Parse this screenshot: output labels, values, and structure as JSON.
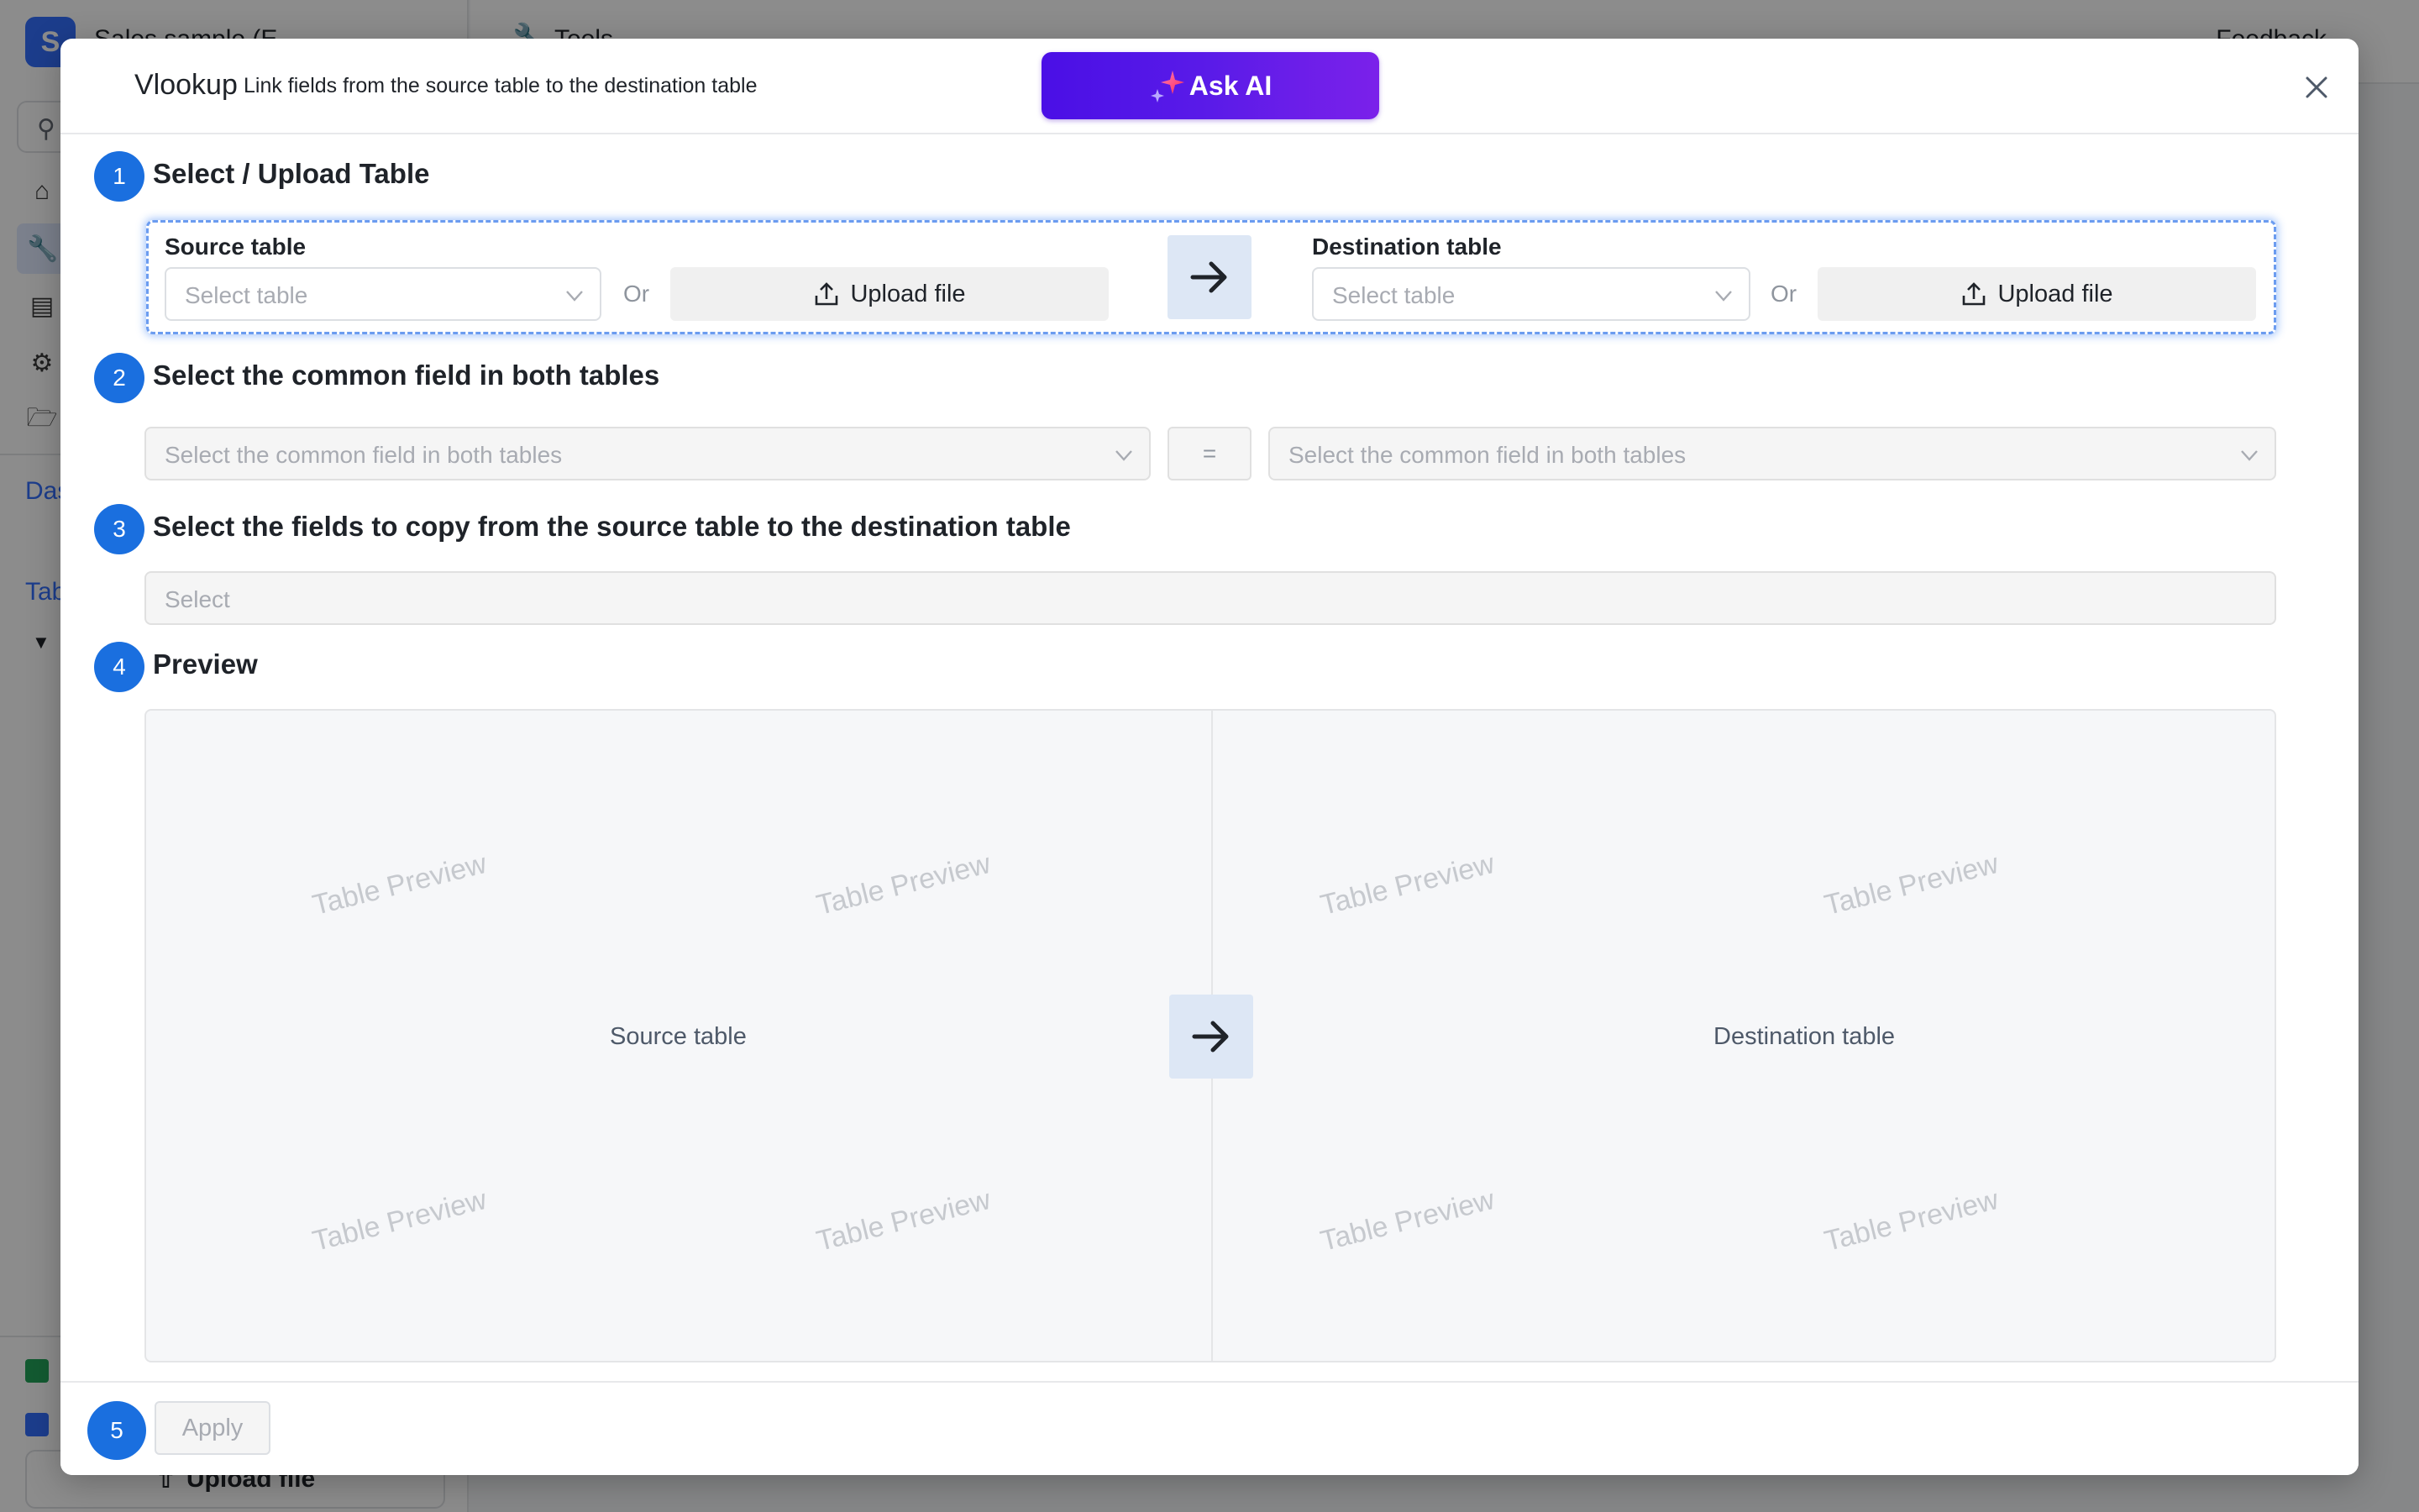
{
  "app": {
    "logo_letter": "S",
    "name": "Sales sample (E",
    "header_title": "Tools",
    "feedback": "Feedback",
    "section_dashboard": "Das",
    "section_tables": "Tab",
    "upload_file": "Upload file"
  },
  "modal": {
    "title": "Vlookup",
    "subtitle": "Link fields from the source table to the destination table",
    "ask_ai": "Ask AI",
    "steps": [
      {
        "number": "1",
        "title": "Select / Upload Table"
      },
      {
        "number": "2",
        "title": "Select the common field in both tables"
      },
      {
        "number": "3",
        "title": "Select the fields to copy from the source table to the destination table"
      },
      {
        "number": "4",
        "title": "Preview"
      },
      {
        "number": "5",
        "title": ""
      }
    ],
    "source": {
      "label": "Source table",
      "placeholder": "Select table",
      "or": "Or",
      "upload": "Upload file"
    },
    "destination": {
      "label": "Destination table",
      "placeholder": "Select table",
      "or": "Or",
      "upload": "Upload file"
    },
    "common_field": {
      "left_placeholder": "Select the common field in both tables",
      "equals": "=",
      "right_placeholder": "Select the common field in both tables"
    },
    "copy_fields": {
      "placeholder": "Select"
    },
    "preview": {
      "watermark": "Table Preview",
      "source_label": "Source table",
      "destination_label": "Destination table"
    },
    "apply": "Apply"
  },
  "colors": {
    "step_badge": "#1a6fdf",
    "ask_ai_start": "#4a0fe6",
    "ask_ai_end": "#7b21ea",
    "highlight_border": "#6b9cf0"
  }
}
